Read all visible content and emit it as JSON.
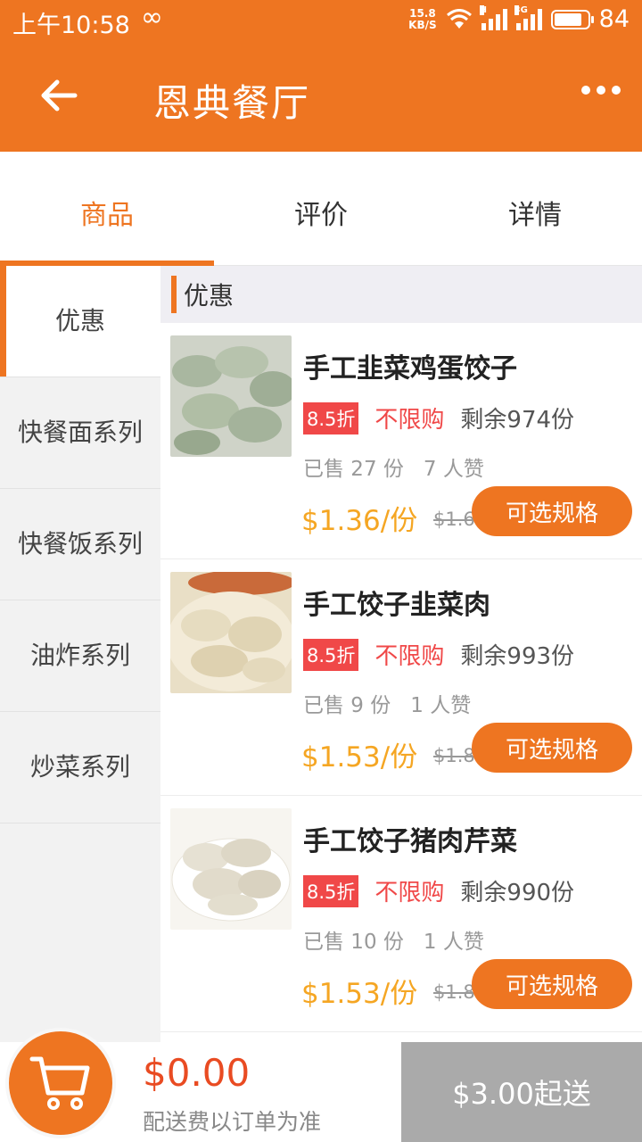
{
  "status_bar": {
    "time": "上午10:58",
    "net_speed_value": "15.8",
    "net_speed_unit": "KB/S",
    "signal1_tag": "H",
    "signal2_tag": "3G",
    "battery": "84"
  },
  "header": {
    "title": "恩典餐厅",
    "accent_color": "#ee7521"
  },
  "tabs": [
    {
      "label": "商品",
      "active": true
    },
    {
      "label": "评价",
      "active": false
    },
    {
      "label": "详情",
      "active": false
    }
  ],
  "sidebar": {
    "items": [
      {
        "label": "优惠",
        "active": true
      },
      {
        "label": "快餐面系列",
        "active": false
      },
      {
        "label": "快餐饭系列",
        "active": false
      },
      {
        "label": "油炸系列",
        "active": false
      },
      {
        "label": "炒菜系列",
        "active": false
      }
    ]
  },
  "section": {
    "title": "优惠"
  },
  "products": [
    {
      "name": "手工韭菜鸡蛋饺子",
      "discount": "8.5折",
      "limit": "不限购",
      "remaining": "剩余974份",
      "sold": "已售 27 份",
      "likes": "7 人赞",
      "price": "$1.36/份",
      "old_price": "$1.60",
      "button": "可选规格"
    },
    {
      "name": "手工饺子韭菜肉",
      "discount": "8.5折",
      "limit": "不限购",
      "remaining": "剩余993份",
      "sold": "已售 9 份",
      "likes": "1 人赞",
      "price": "$1.53/份",
      "old_price": "$1.80",
      "button": "可选规格"
    },
    {
      "name": "手工饺子猪肉芹菜",
      "discount": "8.5折",
      "limit": "不限购",
      "remaining": "剩余990份",
      "sold": "已售 10 份",
      "likes": "1 人赞",
      "price": "$1.53/份",
      "old_price": "$1.80",
      "button": "可选规格"
    }
  ],
  "bottom": {
    "total": "$0.00",
    "note": "配送费以订单为准",
    "min_order": "$3.00起送"
  }
}
